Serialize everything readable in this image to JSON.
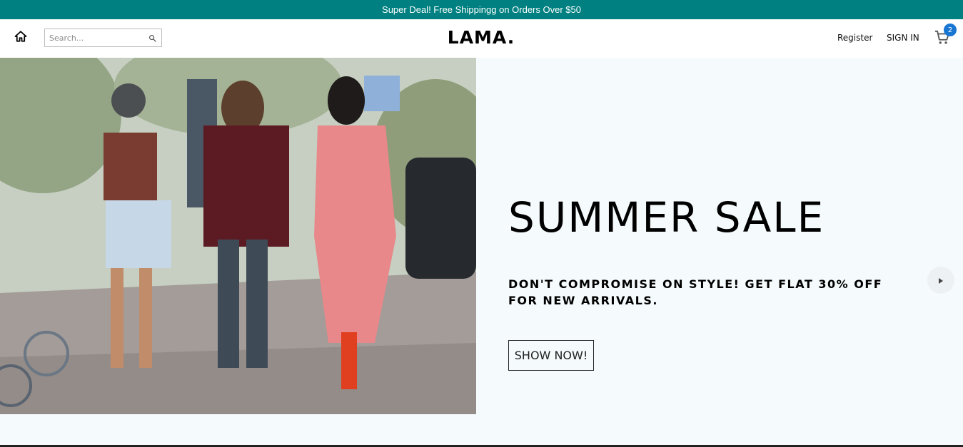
{
  "announcement": {
    "text": "Super Deal! Free Shippingg on Orders Over $50"
  },
  "navbar": {
    "search_placeholder": "Search...",
    "logo": "LAMA.",
    "register_label": "Register",
    "signin_label": "SIGN IN",
    "cart_count": "2",
    "icons": {
      "home": "home-icon",
      "search": "search-icon",
      "cart": "cart-icon"
    }
  },
  "slide": {
    "title": "SUMMER SALE",
    "description": "DON'T COMPROMISE ON STYLE! GET FLAT 30% OFF FOR NEW ARRIVALS.",
    "button_label": "SHOW NOW!",
    "image": "three-women-walking-street-photo"
  },
  "colors": {
    "announcement_bg": "#008080",
    "slide_bg": "#f5fafd",
    "badge": "#1976d2"
  }
}
